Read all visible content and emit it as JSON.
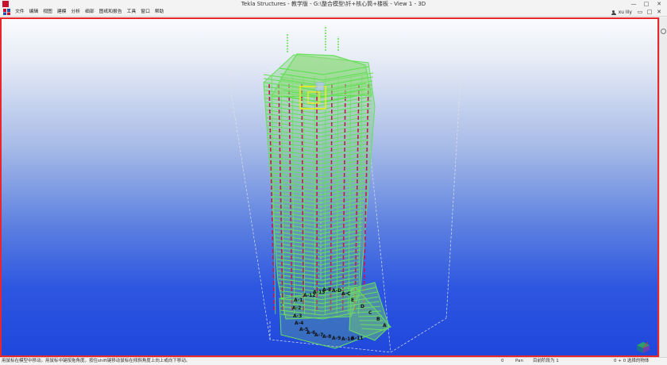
{
  "titlebar": {
    "title": "Tekla Structures - 教学版 - G:\\整合模型\\钎+核心筒+楼板 - View 1 - 3D",
    "minimize": "—",
    "maximize": "□",
    "close": "✕"
  },
  "menu": {
    "items": [
      "文件",
      "编辑",
      "视图",
      "建模",
      "分析",
      "细部",
      "图纸和报告",
      "工具",
      "窗口",
      "帮助"
    ],
    "user_name": "xu lily",
    "controls": [
      "▭",
      "□",
      "✕"
    ]
  },
  "status": {
    "message": "用鼠标在模型中移动。用鼠标中键按拖角度。按住shift键移动鼠标在倾斜角度上向上或向下移动。",
    "count": "0",
    "mode": "Pan",
    "current_phase": "目前阶段为 1",
    "selection": "0 + 0 选择的物体"
  },
  "viewport": {
    "view_name": "View 1 - 3D",
    "labels": [
      "A-1",
      "A-2",
      "A-3",
      "A-4",
      "A-5",
      "A-6",
      "A-7",
      "A-8",
      "A-9",
      "A-10",
      "A-11",
      "A-12",
      "A-13",
      "A-E",
      "A-D",
      "A-C",
      "E",
      "D",
      "C",
      "B",
      "A"
    ]
  },
  "colors": {
    "frame": "#e8262b",
    "structure": "#66e05a",
    "column": "#c2185b",
    "highlight": "#f5f000",
    "box": "#dfe3ea"
  }
}
